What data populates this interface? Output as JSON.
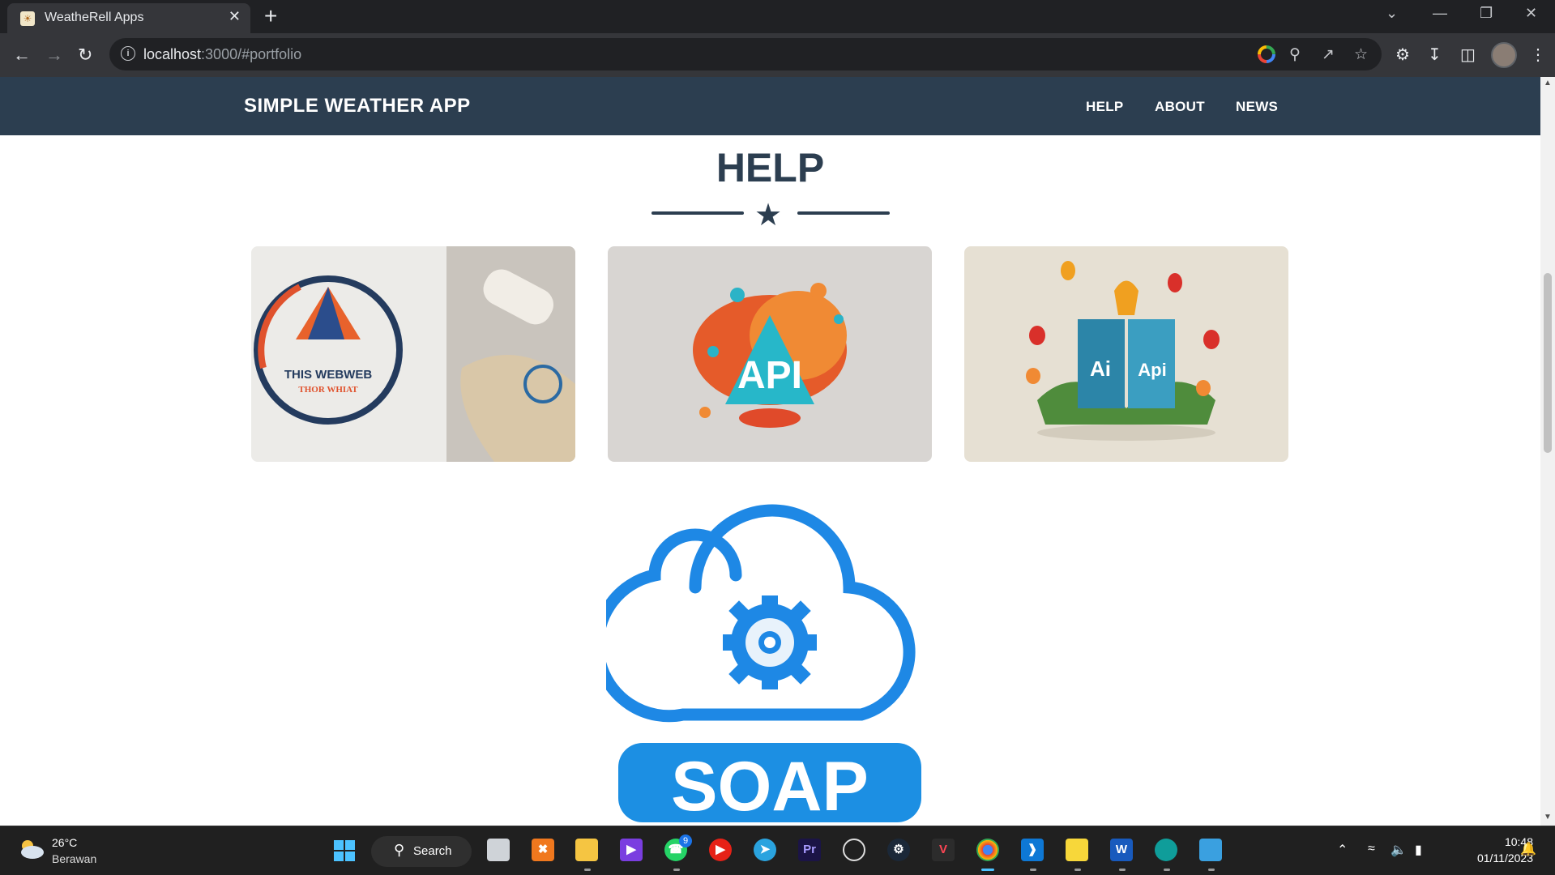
{
  "browser": {
    "tab_title": "WeatheRell Apps",
    "url_host": "localhost",
    "url_rest": ":3000/#portfolio"
  },
  "navbar": {
    "brand": "SIMPLE WEATHER APP",
    "links": [
      "HELP",
      "ABOUT",
      "NEWS"
    ]
  },
  "section": {
    "title": "HELP"
  },
  "cards": [
    {
      "image": "logo-mockup",
      "logo_text": "THIS WEBWEB",
      "logo_subtext": "THOR WHIAT"
    },
    {
      "image": "api-illustration",
      "logo_text": "API"
    },
    {
      "image": "ai-api-book-flowers",
      "book_left": "Ai",
      "book_right": "Api"
    }
  ],
  "soap_logo": {
    "text": "SOAP"
  },
  "taskbar": {
    "weather_temp": "26°C",
    "weather_cond": "Berawan",
    "search_label": "Search",
    "whatsapp_badge": "9",
    "clock_time": "10:48",
    "clock_date": "01/11/2023"
  },
  "colors": {
    "navbar_bg": "#2c3e50",
    "heading": "#2c3e50",
    "soap_blue": "#1e88e5"
  }
}
